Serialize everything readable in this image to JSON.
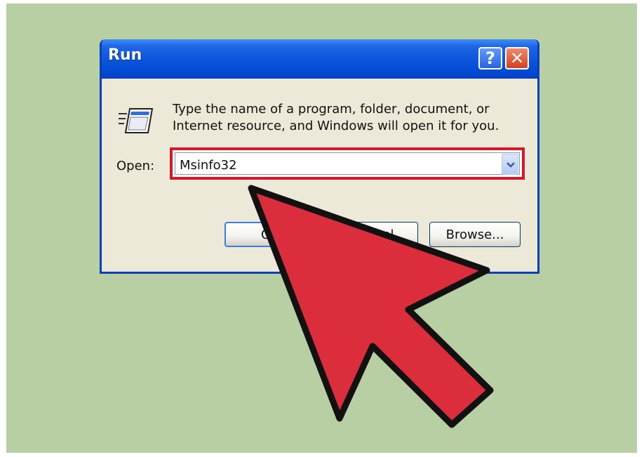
{
  "window": {
    "title": "Run",
    "help_button": "?",
    "close_button": "✕"
  },
  "dialog": {
    "prompt_line1": "Type the name of a program, folder, document, or",
    "prompt_line2": "Internet resource, and Windows will open it for you.",
    "open_label": "Open:",
    "open_value": "Msinfo32",
    "buttons": {
      "ok": "OK",
      "cancel": "Cancel",
      "browse": "Browse..."
    }
  },
  "annotation": {
    "highlight_color": "#d21a2a",
    "arrow_color": "#dc2d3c",
    "arrow_outline": "#111111"
  },
  "colors": {
    "background": "#b7cfa3",
    "titlebar": "#0a55dc",
    "dialog_face": "#ece9d8"
  },
  "icons": {
    "run": "run-icon",
    "dropdown": "chevron-down-icon",
    "pointer": "cursor-arrow-icon"
  }
}
